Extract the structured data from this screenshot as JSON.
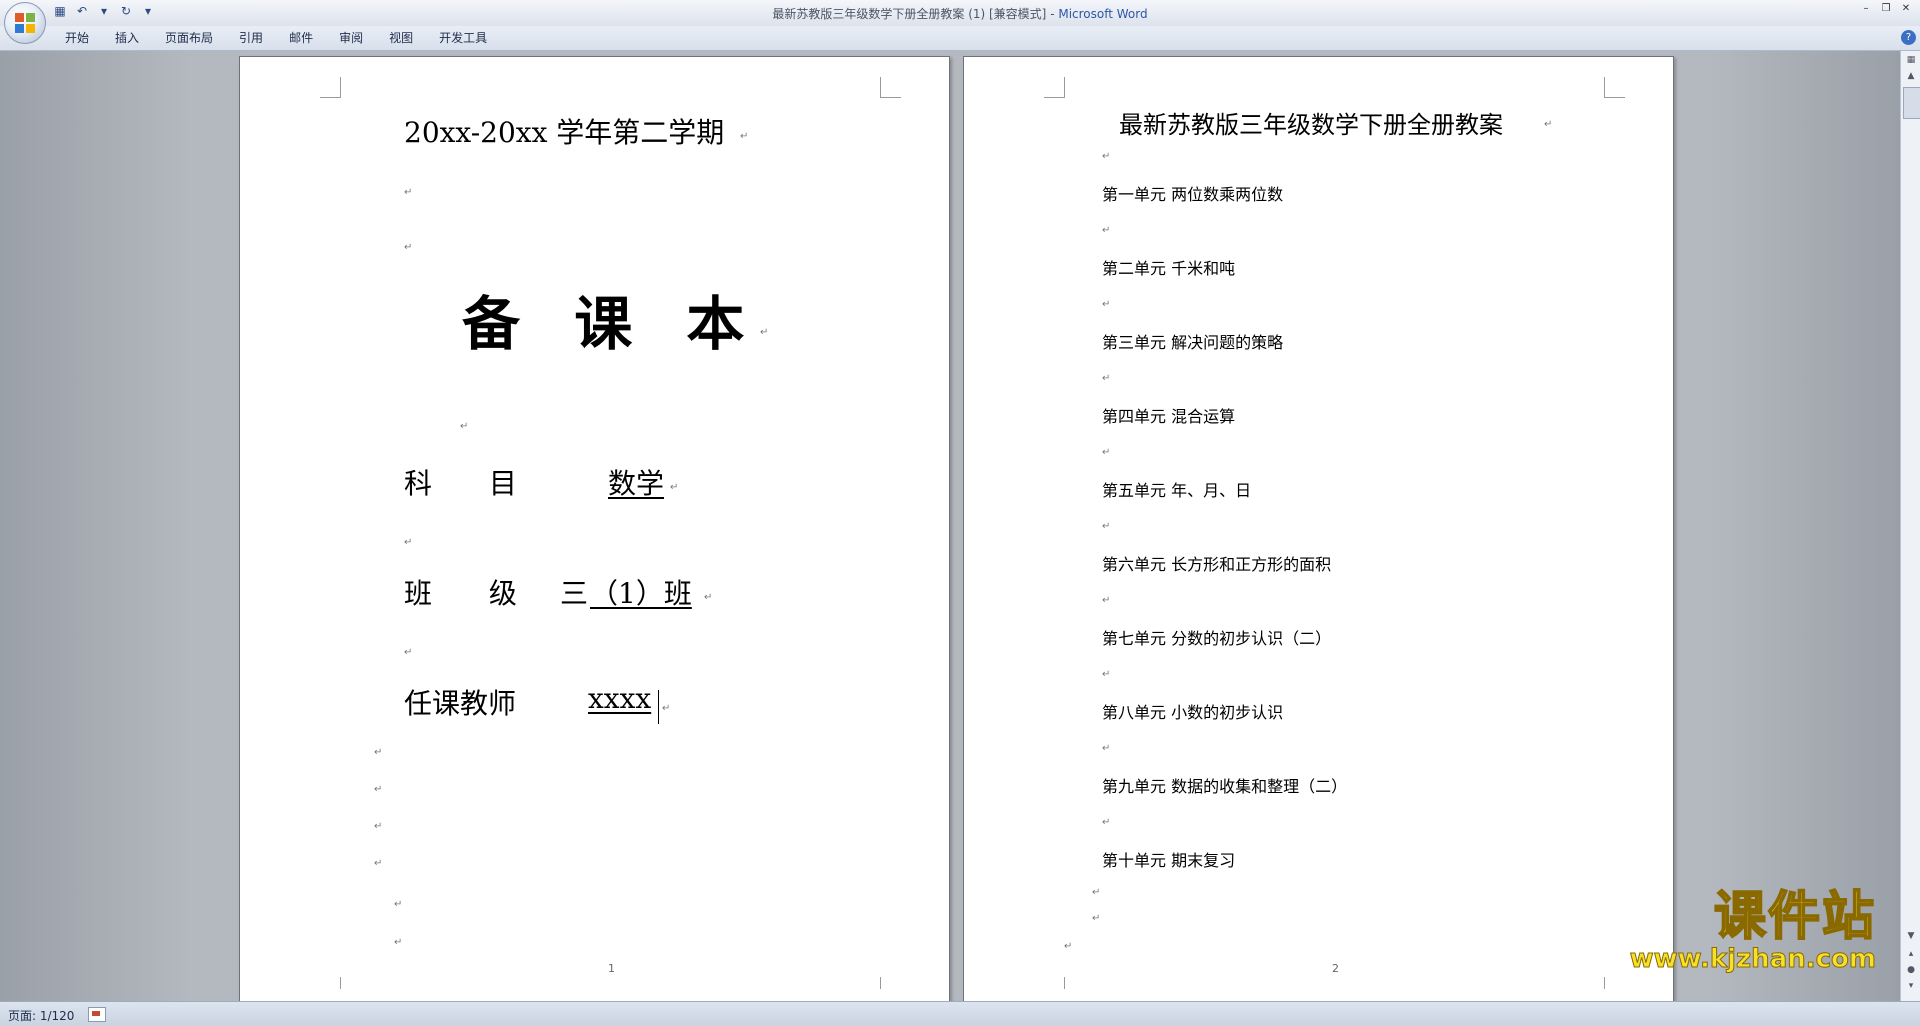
{
  "window": {
    "doc_title": "最新苏教版三年级数学下册全册教案 (1) [兼容模式]",
    "separator": " - ",
    "app_name": "Microsoft Word"
  },
  "qat": {
    "save_icon": "save-icon",
    "undo_icon": "undo-icon",
    "redo_icon": "redo-icon"
  },
  "ribbon": {
    "tabs": [
      "开始",
      "插入",
      "页面布局",
      "引用",
      "邮件",
      "审阅",
      "视图",
      "开发工具"
    ]
  },
  "page1": {
    "year_line": "20xx-20xx 学年第二学期",
    "big_title": "备 课 本",
    "subject_label": "科 目",
    "subject_value": "数学",
    "class_label": "班 级",
    "class_value_prefix": "三",
    "class_value": "（1）班",
    "teacher_label": "任课教师",
    "teacher_value": "xxxx",
    "page_number": "1"
  },
  "page2": {
    "title": "最新苏教版三年级数学下册全册教案",
    "units": [
      "第一单元 两位数乘两位数",
      "第二单元 千米和吨",
      "第三单元 解决问题的策略",
      "第四单元 混合运算",
      "第五单元 年、月、日",
      "第六单元 长方形和正方形的面积",
      "第七单元 分数的初步认识（二）",
      "第八单元 小数的初步认识",
      "第九单元 数据的收集和整理（二）",
      "第十单元 期末复习"
    ],
    "page_number": "2"
  },
  "status": {
    "page_info": "页面: 1/120"
  },
  "watermark": {
    "brand": "课件站",
    "url": "www.kjzhan.com"
  },
  "colors": {
    "app_name": "#2d56a8",
    "watermark": "#f5e12a"
  }
}
